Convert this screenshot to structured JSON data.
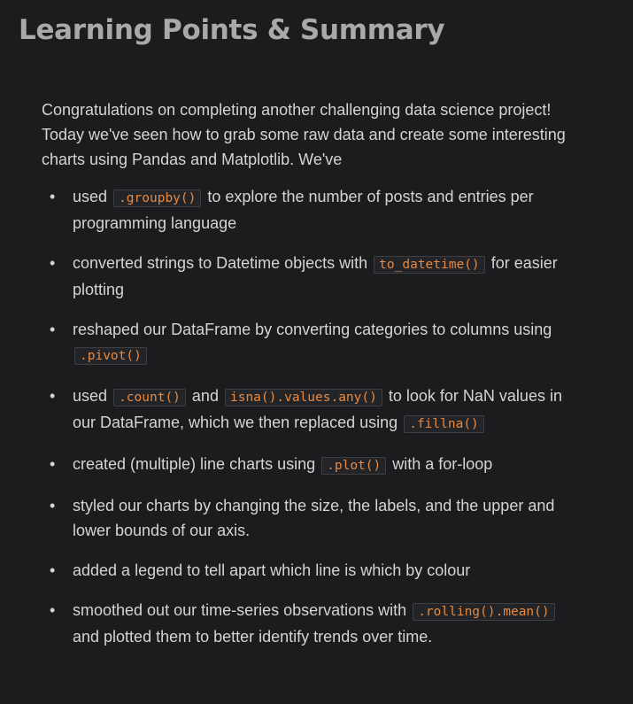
{
  "heading": "Learning Points & Summary",
  "intro": "Congratulations on completing another challenging data science project! Today we've seen how to grab some raw data and create some interesting charts using Pandas and Matplotlib. We've",
  "bullet_glyph": "•",
  "points": [
    {
      "t1": "used",
      "c1": ".groupby()",
      "t2": "to explore the number of posts and entries per programming language"
    },
    {
      "t1": "converted strings to Datetime objects with",
      "c1": "to_datetime()",
      "t2": "for easier plotting"
    },
    {
      "t1": "reshaped our DataFrame by converting categories to columns using",
      "c1": ".pivot()",
      "t2": ""
    },
    {
      "t1": "used",
      "c1": ".count()",
      "t2": "and",
      "c2": "isna().values.any()",
      "t3": "to look for NaN values in our DataFrame, which we then replaced using",
      "c3": ".fillna()"
    },
    {
      "t1": "created (multiple) line charts using",
      "c1": ".plot()",
      "t2": "with a for-loop"
    },
    {
      "t1": "styled our charts by changing the size, the labels, and the upper and lower bounds of our axis."
    },
    {
      "t1": "added a legend to tell apart which line is which by colour"
    },
    {
      "t1": "smoothed out our time-series observations with",
      "c1": ".rolling().mean()",
      "t2": "and plotted them to better identify trends over time."
    }
  ]
}
